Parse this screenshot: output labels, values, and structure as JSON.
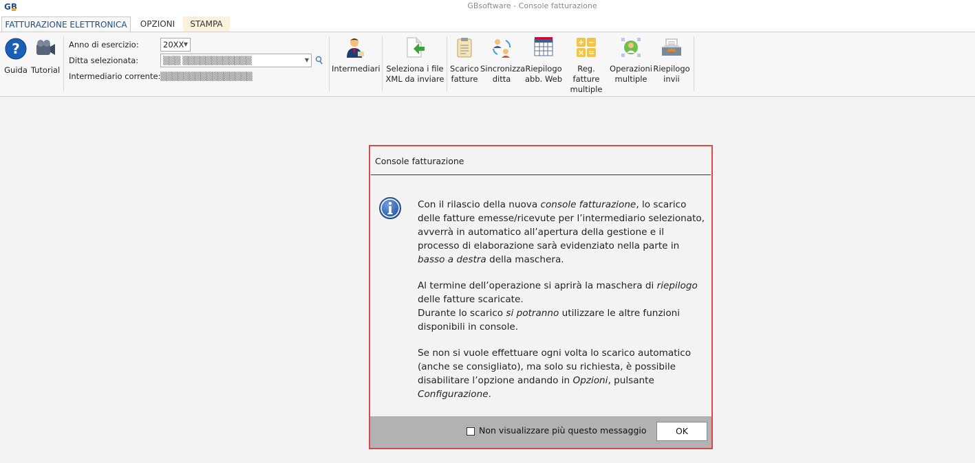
{
  "app": {
    "title": "GBsoftware - Console fatturazione",
    "logo_text": "GB"
  },
  "tabs": [
    {
      "label": "FATTURAZIONE ELETTRONICA",
      "active": true
    },
    {
      "label": "OPZIONI",
      "active": false
    },
    {
      "label": "STAMPA",
      "active": false
    }
  ],
  "ribbon": {
    "guida_label": "Guida",
    "tutorial_label": "Tutorial",
    "anno_label": "Anno di esercizio:",
    "anno_value": "20XX",
    "ditta_label": "Ditta selezionata:",
    "ditta_value": "▒▒▒ ▒▒▒▒▒▒▒▒▒▒▒▒",
    "intermediario_label": "Intermediario corrente:",
    "intermediario_value": "▒▒▒▒▒▒▒▒▒▒▒▒▒▒▒▒",
    "intermediari_label": "Intermediari",
    "seleziona_label": "Seleziona i file\nXML da inviare",
    "scarico_label": "Scarico\nfatture",
    "sincronizza_label": "Sincronizza\nditta",
    "riepilogo_web_label": "Riepilogo\nabb. Web",
    "reg_fatture_label": "Reg. fatture\nmultiple",
    "operazioni_label": "Operazioni\nmultiple",
    "riepilogo_invii_label": "Riepilogo\ninvii"
  },
  "dialog": {
    "title": "Console fatturazione",
    "p1_a": "Con il rilascio della nuova ",
    "p1_b": "console fatturazione",
    "p1_c": ", lo scarico delle fatture emesse/ricevute per l’intermediario selezionato, avverrà in automatico all’apertura della gestione e il processo di elaborazione sarà evidenziato nella parte in ",
    "p1_d": "basso a destra",
    "p1_e": " della maschera.",
    "p2_a": "Al termine dell’operazione si aprirà la maschera di ",
    "p2_b": "riepilogo",
    "p2_c": " delle fatture scaricate.",
    "p2_d": "Durante lo scarico ",
    "p2_e": "si potranno",
    "p2_f": " utilizzare le altre funzioni disponibili in console.",
    "p3_a": "Se non si vuole effettuare ogni volta lo scarico automatico (anche se consigliato), ma solo su richiesta, è possibile disabilitare l’opzione andando in ",
    "p3_b": "Opzioni",
    "p3_c": ", pulsante ",
    "p3_d": "Configurazione",
    "p3_e": ".",
    "checkbox_label": "Non visualizzare più questo messaggio",
    "checkbox_checked": false,
    "ok_label": "OK"
  }
}
